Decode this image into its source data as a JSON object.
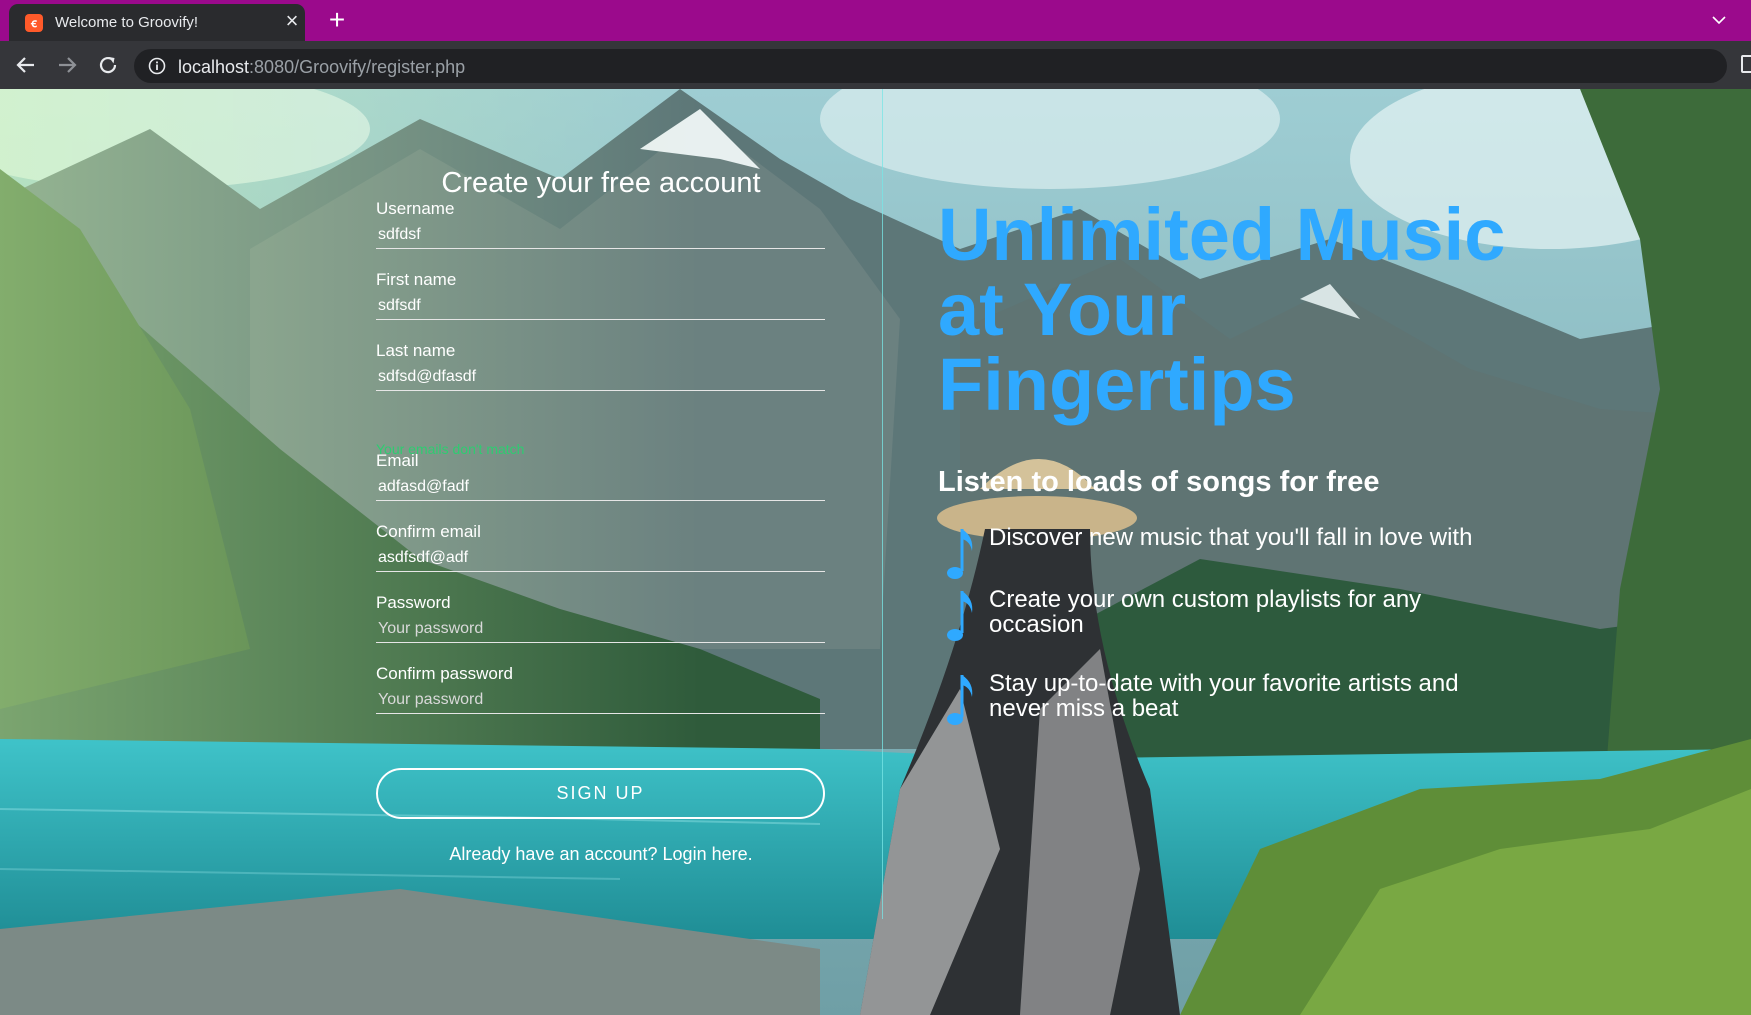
{
  "browser": {
    "tab_title": "Welcome to Groovify!",
    "tab_close": "×",
    "new_tab": "+",
    "url_host": "localhost",
    "url_rest": ":8080/Groovify/register.php",
    "chrome_color": "#9b0a8c"
  },
  "form": {
    "title": "Create your free account",
    "fields": [
      {
        "label": "Username",
        "value": "sdfdsf",
        "placeholder": ""
      },
      {
        "label": "First name",
        "value": "sdfsdf",
        "placeholder": ""
      },
      {
        "label": "Last name",
        "value": "sdfsd@dfasdf",
        "placeholder": ""
      },
      {
        "label": "Email",
        "value": "adfasd@fadf",
        "placeholder": ""
      },
      {
        "label": "Confirm email",
        "value": "asdfsdf@adf",
        "placeholder": ""
      },
      {
        "label": "Password",
        "value": "",
        "placeholder": "Your password"
      },
      {
        "label": "Confirm password",
        "value": "",
        "placeholder": "Your password"
      }
    ],
    "error": "Your emails don't match",
    "error_color": "#2ecc71",
    "signup_label": "SIGN UP",
    "login_link": "Already have an account? Login here."
  },
  "promo": {
    "headline_lines": [
      "Unlimited Music",
      "at Your",
      "Fingertips"
    ],
    "headline_color": "#2fa9ff",
    "subheading": "Listen to loads of songs for free",
    "features": [
      {
        "icon": "music-note-icon",
        "text": "Discover new music that you'll fall in love with"
      },
      {
        "icon": "music-note-icon",
        "text": "Create your own custom playlists for any occasion"
      },
      {
        "icon": "music-note-icon",
        "text": "Stay up-to-date with your favorite artists and never miss a beat"
      }
    ]
  }
}
